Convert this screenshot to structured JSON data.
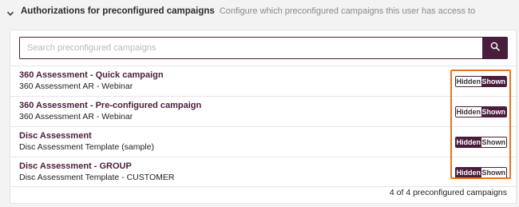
{
  "header": {
    "title": "Authorizations for preconfigured campaigns",
    "subtitle": "Configure which preconfigured campaigns this user has access to"
  },
  "search": {
    "placeholder": "Search preconfigured campaigns",
    "value": ""
  },
  "toggle_labels": {
    "hidden": "Hidden",
    "shown": "Shown"
  },
  "campaigns": [
    {
      "title": "360 Assessment - Quick campaign",
      "template": "360 Assessment AR - Webinar",
      "state": "shown"
    },
    {
      "title": "360 Assessment - Pre-configured campaign",
      "template": "360 Assessment AR - Webinar",
      "state": "shown"
    },
    {
      "title": "Disc Assessment",
      "template": "Disc Assessment Template (sample)",
      "state": "hidden"
    },
    {
      "title": "Disc Assessment - GROUP",
      "template": "Disc Assessment Template - CUSTOMER",
      "state": "hidden"
    }
  ],
  "footer": {
    "count_text": "4 of 4 preconfigured campaigns"
  },
  "colors": {
    "accent": "#4a1d3d",
    "highlight": "#e8741e",
    "panel_bg": "#f3f3f4"
  },
  "icons": {
    "collapse": "chevron-down-icon",
    "search": "search-icon"
  }
}
